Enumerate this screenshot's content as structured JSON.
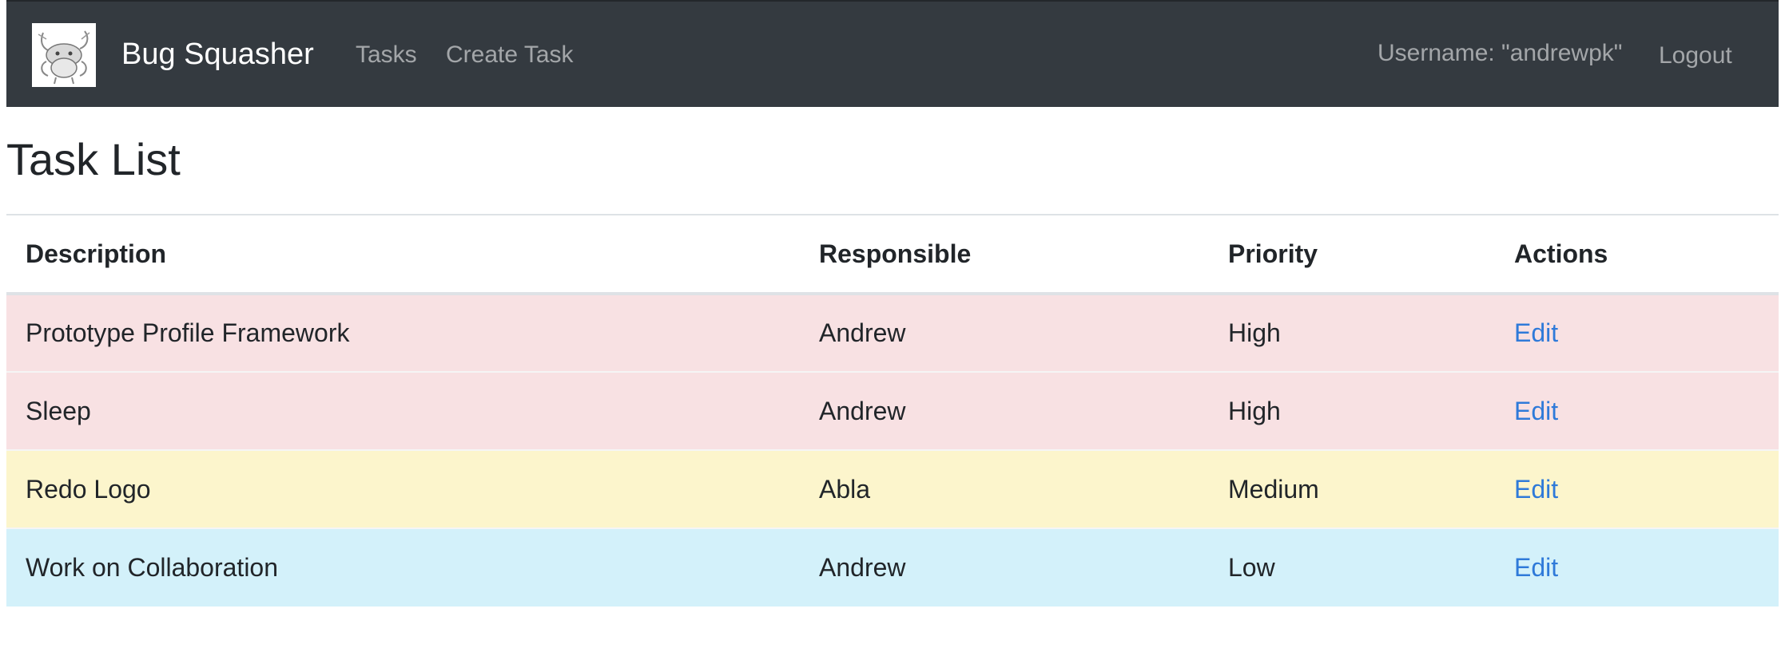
{
  "navbar": {
    "brand": "Bug Squasher",
    "links": [
      "Tasks",
      "Create Task"
    ],
    "username_text": "Username: \"andrewpk\"",
    "logout_label": "Logout",
    "bg_color": "#343a40"
  },
  "page": {
    "title": "Task List"
  },
  "table": {
    "headers": [
      "Description",
      "Responsible",
      "Priority",
      "Actions"
    ],
    "rows": [
      {
        "description": "Prototype Profile Framework",
        "responsible": "Andrew",
        "priority": "High",
        "action": "Edit",
        "row_color": "#f8e1e3"
      },
      {
        "description": "Sleep",
        "responsible": "Andrew",
        "priority": "High",
        "action": "Edit",
        "row_color": "#f8e1e3"
      },
      {
        "description": "Redo Logo",
        "responsible": "Abla",
        "priority": "Medium",
        "action": "Edit",
        "row_color": "#fcf5cc"
      },
      {
        "description": "Work on Collaboration",
        "responsible": "Andrew",
        "priority": "Low",
        "action": "Edit",
        "row_color": "#d3f1fa"
      }
    ]
  }
}
